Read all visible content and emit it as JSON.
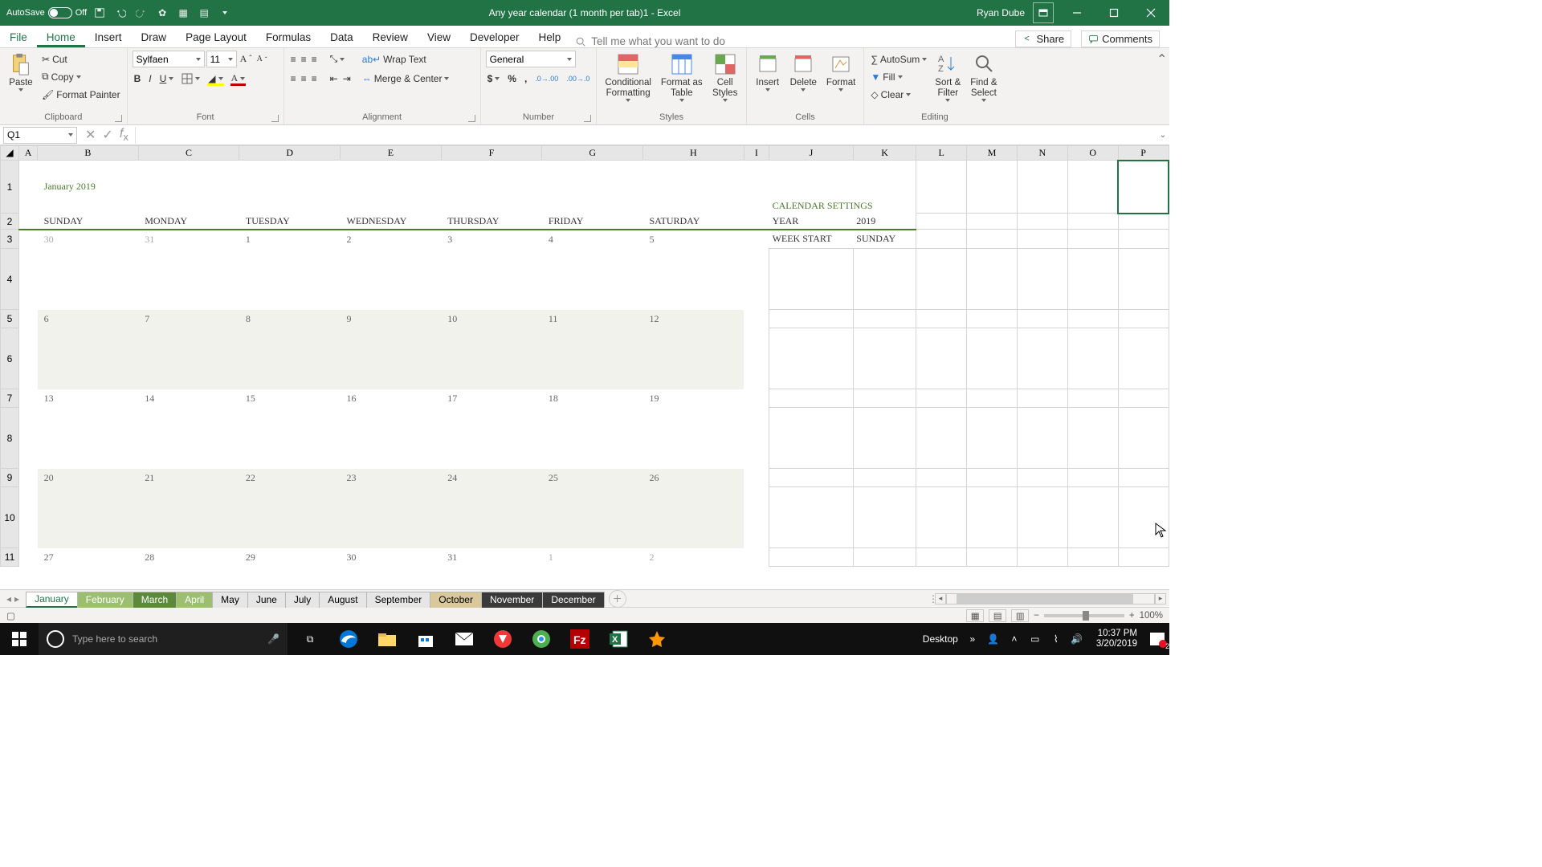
{
  "titlebar": {
    "autosave_label": "AutoSave",
    "autosave_state": "Off",
    "doc_title": "Any year calendar (1 month per tab)1  -  Excel",
    "user": "Ryan Dube"
  },
  "ribbon_tabs": [
    "File",
    "Home",
    "Insert",
    "Draw",
    "Page Layout",
    "Formulas",
    "Data",
    "Review",
    "View",
    "Developer",
    "Help"
  ],
  "tellme_placeholder": "Tell me what you want to do",
  "share_label": "Share",
  "comments_label": "Comments",
  "ribbon": {
    "clipboard": {
      "paste": "Paste",
      "cut": "Cut",
      "copy": "Copy",
      "painter": "Format Painter",
      "label": "Clipboard"
    },
    "font": {
      "name": "Sylfaen",
      "size": "11",
      "label": "Font"
    },
    "alignment": {
      "wrap": "Wrap Text",
      "merge": "Merge & Center",
      "label": "Alignment"
    },
    "number": {
      "format": "General",
      "label": "Number"
    },
    "styles": {
      "cond": "Conditional\nFormatting",
      "table": "Format as\nTable",
      "cell": "Cell\nStyles",
      "label": "Styles"
    },
    "cells": {
      "insert": "Insert",
      "delete": "Delete",
      "format": "Format",
      "label": "Cells"
    },
    "editing": {
      "autosum": "AutoSum",
      "fill": "Fill",
      "clear": "Clear",
      "sort": "Sort &\nFilter",
      "find": "Find &\nSelect",
      "label": "Editing"
    }
  },
  "namebox": "Q1",
  "columns": [
    "A",
    "B",
    "C",
    "D",
    "E",
    "F",
    "G",
    "H",
    "I",
    "J",
    "K",
    "L",
    "M",
    "N",
    "O",
    "P"
  ],
  "row_numbers": [
    "1",
    "2",
    "3",
    "4",
    "5",
    "6",
    "7",
    "8",
    "9",
    "10",
    "11"
  ],
  "calendar": {
    "title": "January 2019",
    "day_headers": [
      "SUNDAY",
      "MONDAY",
      "TUESDAY",
      "WEDNESDAY",
      "THURSDAY",
      "FRIDAY",
      "SATURDAY"
    ],
    "weeks": [
      {
        "nums": [
          "30",
          "31",
          "1",
          "2",
          "3",
          "4",
          "5"
        ],
        "muted": [
          true,
          true,
          false,
          false,
          false,
          false,
          false
        ]
      },
      {
        "nums": [
          "6",
          "7",
          "8",
          "9",
          "10",
          "11",
          "12"
        ],
        "muted": [
          false,
          false,
          false,
          false,
          false,
          false,
          false
        ]
      },
      {
        "nums": [
          "13",
          "14",
          "15",
          "16",
          "17",
          "18",
          "19"
        ],
        "muted": [
          false,
          false,
          false,
          false,
          false,
          false,
          false
        ]
      },
      {
        "nums": [
          "20",
          "21",
          "22",
          "23",
          "24",
          "25",
          "26"
        ],
        "muted": [
          false,
          false,
          false,
          false,
          false,
          false,
          false
        ]
      },
      {
        "nums": [
          "27",
          "28",
          "29",
          "30",
          "31",
          "1",
          "2"
        ],
        "muted": [
          false,
          false,
          false,
          false,
          false,
          true,
          true
        ]
      }
    ],
    "settings_hdr": "CALENDAR SETTINGS",
    "year_lbl": "YEAR",
    "year_val": "2019",
    "weekstart_lbl": "WEEK START",
    "weekstart_val": "SUNDAY"
  },
  "sheet_tabs": [
    "January",
    "February",
    "March",
    "April",
    "May",
    "June",
    "July",
    "August",
    "September",
    "October",
    "November",
    "December"
  ],
  "statusbar": {
    "desktop": "Desktop",
    "zoom": "100%"
  },
  "taskbar": {
    "search_placeholder": "Type here to search",
    "time": "10:37 PM",
    "date": "3/20/2019",
    "notif_count": "2"
  }
}
